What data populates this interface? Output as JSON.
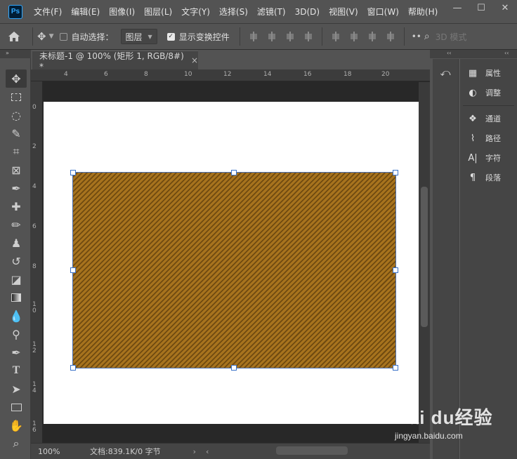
{
  "app": {
    "logo_text": "Ps"
  },
  "menu": [
    "文件(F)",
    "编辑(E)",
    "图像(I)",
    "图层(L)",
    "文字(Y)",
    "选择(S)",
    "滤镜(T)",
    "3D(D)",
    "视图(V)",
    "窗口(W)",
    "帮助(H)"
  ],
  "window_controls": {
    "minimize": "—",
    "maximize": "☐",
    "close": "✕"
  },
  "options": {
    "auto_select_label": "自动选择：",
    "auto_select_checked": false,
    "auto_select_target": "图层",
    "show_transform_label": "显示变换控件",
    "show_transform_checked": true,
    "mode_3d": "3D 模式"
  },
  "document": {
    "tab_title": "未标题-1 @ 100% (矩形 1, RGB/8#) *",
    "close_symbol": "×",
    "zoom": "100%",
    "doc_info": "文档:839.1K/0 字节"
  },
  "ruler": {
    "top_labels": [
      "4",
      "6",
      "8",
      "10",
      "12",
      "14",
      "16",
      "18",
      "20"
    ],
    "left_labels": [
      "0",
      "2",
      "4",
      "6",
      "8",
      "10",
      "12",
      "14",
      "16"
    ]
  },
  "shape": {
    "fill_light": "#a7731e",
    "fill_dark": "#6f4a10",
    "selection_color": "#3a72c8"
  },
  "panels": [
    {
      "label": "属性",
      "icon": "properties-icon"
    },
    {
      "label": "调整",
      "icon": "adjustments-icon"
    },
    {
      "label": "通道",
      "icon": "channels-icon"
    },
    {
      "label": "路径",
      "icon": "paths-icon"
    },
    {
      "label": "字符",
      "icon": "character-icon"
    },
    {
      "label": "段落",
      "icon": "paragraph-icon"
    }
  ],
  "tools": [
    "move-tool-icon",
    "marquee-tool-icon",
    "lasso-tool-icon",
    "quick-select-tool-icon",
    "crop-tool-icon",
    "frame-tool-icon",
    "eyedropper-tool-icon",
    "healing-brush-tool-icon",
    "brush-tool-icon",
    "clone-stamp-tool-icon",
    "history-brush-tool-icon",
    "eraser-tool-icon",
    "gradient-tool-icon",
    "blur-tool-icon",
    "dodge-tool-icon",
    "pen-tool-icon",
    "type-tool-icon",
    "path-select-tool-icon",
    "rectangle-tool-icon",
    "hand-tool-icon",
    "zoom-tool-icon"
  ],
  "watermark": {
    "main": "Bai du经验",
    "sub": "jingyan.baidu.com"
  }
}
